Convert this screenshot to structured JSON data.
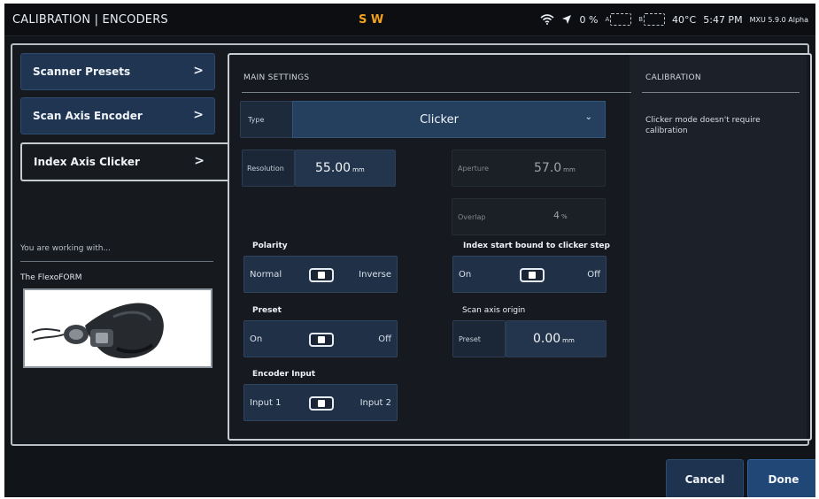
{
  "header": {
    "title": "CALIBRATION | ENCODERS",
    "direction": "S W",
    "status": {
      "battery_percent": "0 %",
      "battery_a": "A",
      "battery_b": "B",
      "temperature": "40°C",
      "time": "5:47 PM",
      "version": "MXU 5.9.0 Alpha"
    }
  },
  "sidebar": {
    "items": [
      {
        "label": "Scanner Presets",
        "chevron": ">"
      },
      {
        "label": "Scan Axis Encoder",
        "chevron": ">"
      },
      {
        "label": "Index Axis Clicker",
        "chevron": ">",
        "active": true
      }
    ],
    "working_with": "You are working with...",
    "device_name": "The FlexoFORM"
  },
  "main": {
    "section_title": "MAIN SETTINGS",
    "type": {
      "label": "Type",
      "value": "Clicker"
    },
    "resolution": {
      "label": "Resolution",
      "value": "55.00",
      "unit": "mm"
    },
    "aperture": {
      "label": "Aperture",
      "value": "57.0",
      "unit": "mm"
    },
    "overlap": {
      "label": "Overlap",
      "value": "4",
      "unit": "%"
    },
    "polarity": {
      "title": "Polarity",
      "left": "Normal",
      "right": "Inverse"
    },
    "index_start": {
      "title": "Index start bound to clicker step",
      "left": "On",
      "right": "Off"
    },
    "preset": {
      "title": "Preset",
      "left": "On",
      "right": "Off"
    },
    "scan_origin": {
      "title": "Scan axis origin",
      "label": "Preset",
      "value": "0.00",
      "unit": "mm"
    },
    "encoder_input": {
      "title": "Encoder Input",
      "left": "Input 1",
      "right": "Input 2"
    }
  },
  "calibration": {
    "section_title": "CALIBRATION",
    "text": "Clicker mode doesn't require calibration"
  },
  "footer": {
    "cancel_label": "Cancel",
    "done_label": "Done"
  }
}
